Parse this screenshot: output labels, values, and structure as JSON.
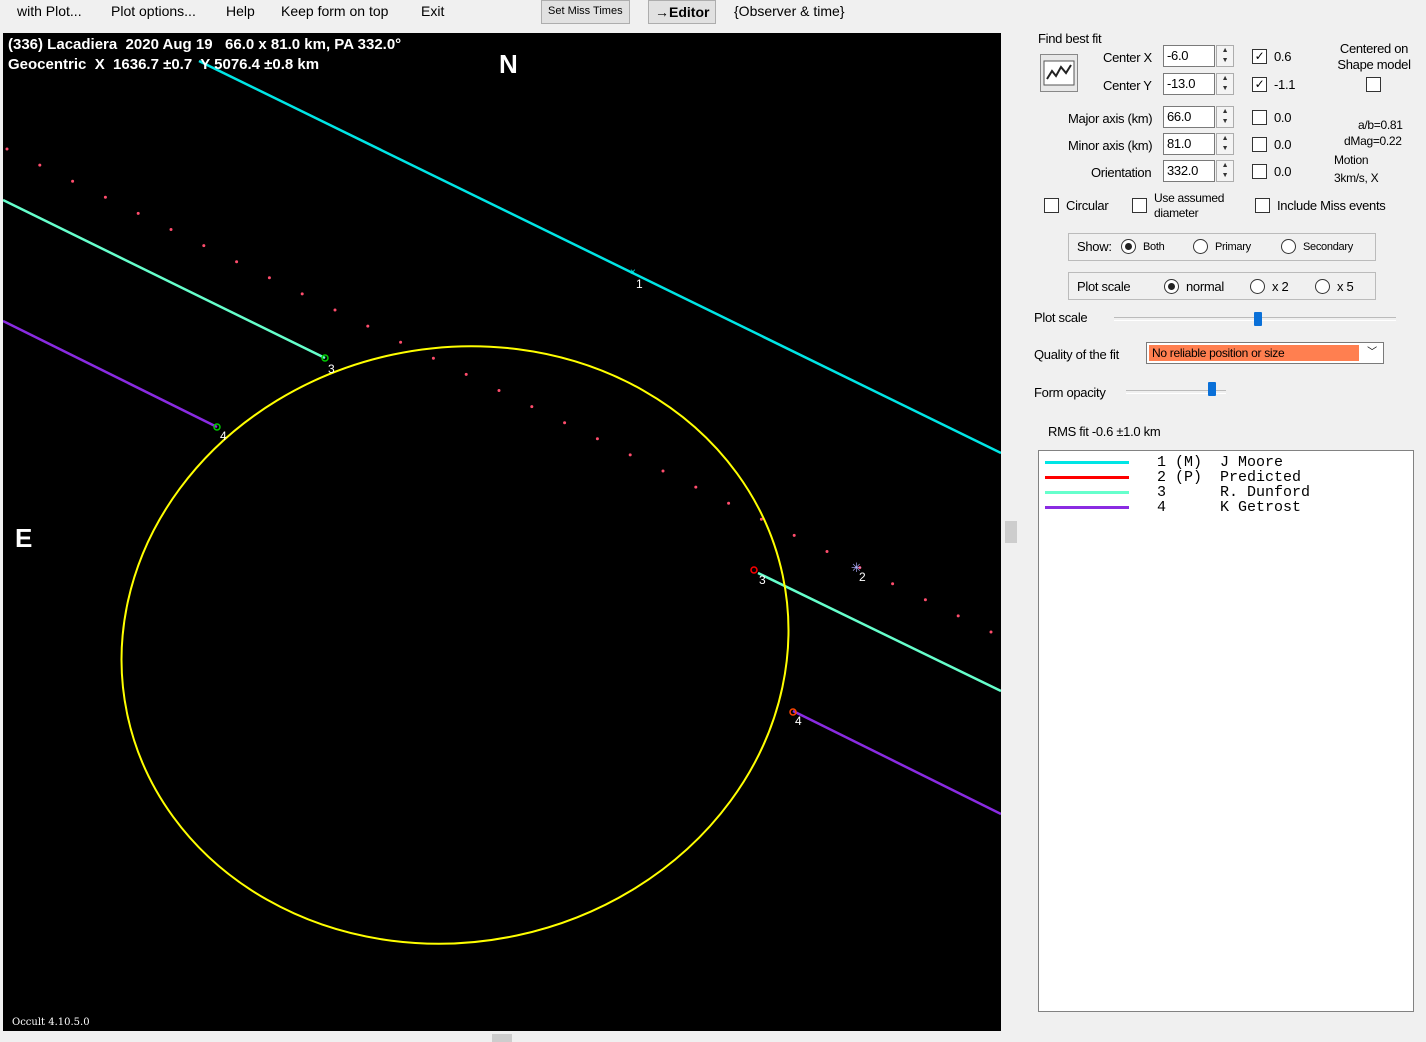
{
  "menu": {
    "with_plot": "with Plot...",
    "plot_options": "Plot options...",
    "help": "Help",
    "keep_on_top": "Keep form on top",
    "exit": "Exit",
    "set_miss_times": "Set Miss Times",
    "editor": "→Editor",
    "observer_time": "{Observer & time}"
  },
  "plot": {
    "header_line1": "(336) Lacadiera  2020 Aug 19   66.0 x 81.0 km, PA 332.0°",
    "header_line2": "Geocentric  X  1636.7 ±0.7  Y 5076.4 ±0.8 km",
    "north": "N",
    "east": "E",
    "version": "Occult 4.10.5.0",
    "colors": {
      "background": "#000000",
      "ellipse": "#ffff00",
      "chord1": "#00e5e5",
      "chord3": "#66ffcc",
      "chord4": "#8a2be2",
      "predicted_dots": "#ff4d6d"
    },
    "chord_labels": [
      "1",
      "2",
      "3",
      "3",
      "4",
      "4"
    ]
  },
  "panel": {
    "find_best_fit": "Find best fit",
    "fit_icon": "chart-fit-icon",
    "center_x_label": "Center X",
    "center_x_value": "-6.0",
    "center_x_fit_checked": true,
    "center_x_fit_value": "0.6",
    "center_y_label": "Center Y",
    "center_y_value": "-13.0",
    "center_y_fit_checked": true,
    "center_y_fit_value": "-1.1",
    "centered_on_shape": "Centered on Shape model",
    "major_label": "Major axis (km)",
    "major_value": "66.0",
    "major_fit_value": "0.0",
    "minor_label": "Minor axis (km)",
    "minor_value": "81.0",
    "minor_fit_value": "0.0",
    "orient_label": "Orientation",
    "orient_value": "332.0",
    "orient_fit_value": "0.0",
    "ab_ratio": "a/b=0.81",
    "dmag": "dMag=0.22",
    "motion_label": "Motion",
    "motion_value": "3km/s, X",
    "circular": "Circular",
    "use_assumed_diameter": "Use assumed diameter",
    "include_miss": "Include Miss events",
    "show_label": "Show:",
    "show_both": "Both",
    "show_primary": "Primary",
    "show_secondary": "Secondary",
    "plot_scale_group": "Plot scale",
    "scale_normal": "normal",
    "scale_x2": "x 2",
    "scale_x5": "x 5",
    "plot_scale_slider_label": "Plot scale",
    "plot_scale_level": 0.51,
    "quality_label": "Quality of the fit",
    "quality_value": "No reliable position or size",
    "quality_color": "#ff7f50",
    "form_opacity_label": "Form opacity",
    "form_opacity_level": 0.86,
    "rms_fit": "RMS fit -0.6 ±1.0 km"
  },
  "legend": [
    {
      "text": "1 (M)  J Moore",
      "color": "#00e5e5"
    },
    {
      "text": "2 (P)  Predicted",
      "color": "#ff0000"
    },
    {
      "text": "3      R. Dunford",
      "color": "#66ffcc"
    },
    {
      "text": "4      K Getrost",
      "color": "#8a2be2"
    }
  ]
}
